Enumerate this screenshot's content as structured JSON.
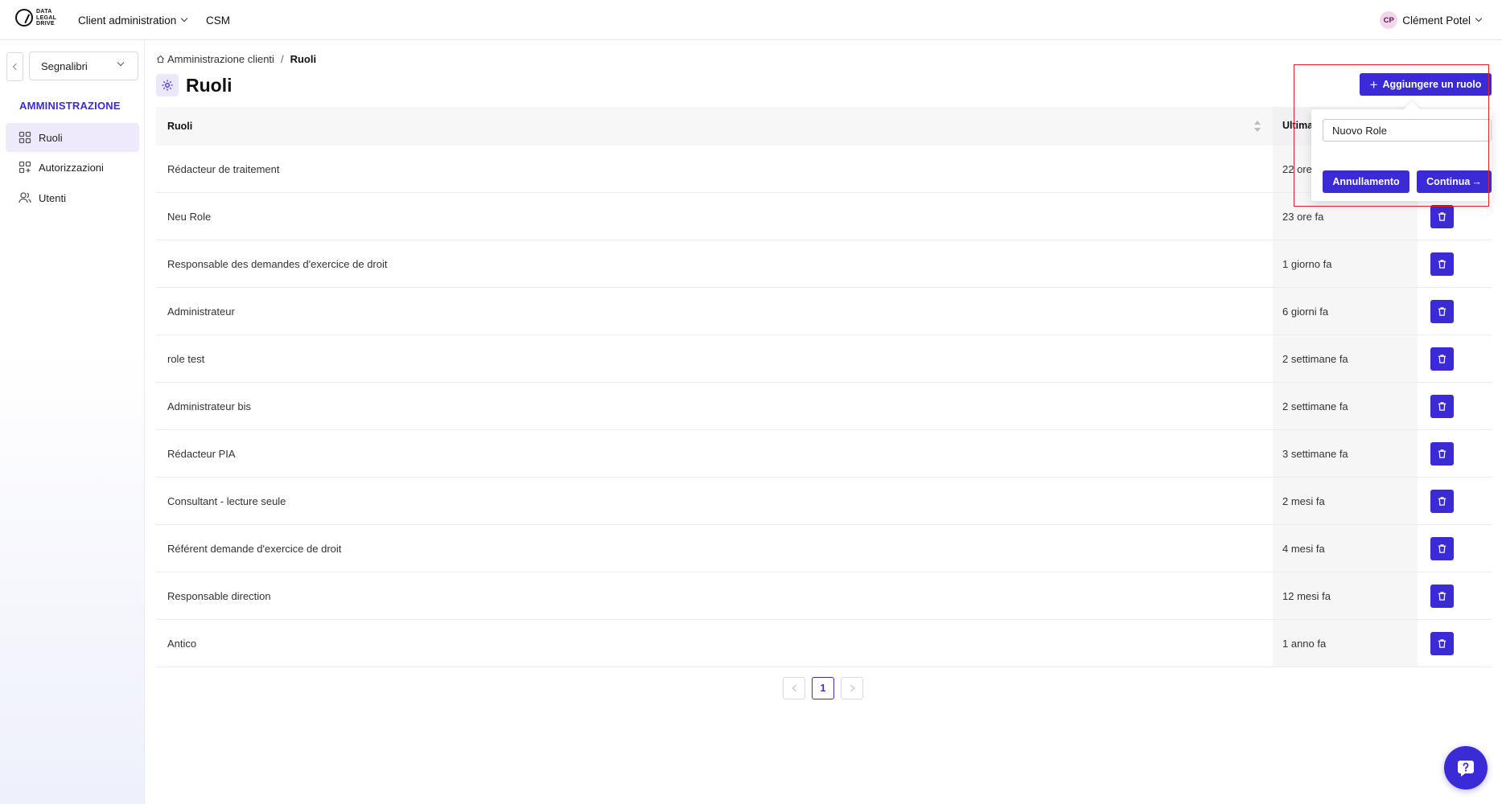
{
  "header": {
    "logo_lines": [
      "DATA",
      "LEGAL",
      "DRIVE"
    ],
    "nav_client": "Client administration",
    "nav_csm": "CSM",
    "user_initials": "CP",
    "user_name": "Clément Potel"
  },
  "sidebar": {
    "bookmarks_label": "Segnalibri",
    "section_title": "AMMINISTRAZIONE",
    "items": [
      {
        "label": "Ruoli",
        "icon": "grid-icon",
        "active": true
      },
      {
        "label": "Autorizzazioni",
        "icon": "nodes-icon",
        "active": false
      },
      {
        "label": "Utenti",
        "icon": "users-icon",
        "active": false
      }
    ]
  },
  "main": {
    "breadcrumb": {
      "home": "Amministrazione clienti",
      "separator": "/",
      "current": "Ruoli"
    },
    "title": "Ruoli",
    "add_button": "Aggiungere un ruolo",
    "table": {
      "col_name": "Ruoli",
      "col_date": "Ultima",
      "rows": [
        {
          "name": "Rédacteur de traitement",
          "date": "22 ore fa"
        },
        {
          "name": "Neu Role",
          "date": "23 ore fa"
        },
        {
          "name": "Responsable des demandes d'exercice de droit",
          "date": "1 giorno fa"
        },
        {
          "name": "Administrateur",
          "date": "6 giorni fa"
        },
        {
          "name": "role test",
          "date": "2 settimane fa"
        },
        {
          "name": "Administrateur bis",
          "date": "2 settimane fa"
        },
        {
          "name": "Rédacteur PIA",
          "date": "3 settimane fa"
        },
        {
          "name": "Consultant - lecture seule",
          "date": "2 mesi fa"
        },
        {
          "name": "Référent demande d'exercice de droit",
          "date": "4 mesi fa"
        },
        {
          "name": "Responsable direction",
          "date": "12 mesi fa"
        },
        {
          "name": "Antico",
          "date": "1 anno fa"
        }
      ]
    },
    "pagination": {
      "current_page": "1"
    }
  },
  "popover": {
    "input_value": "Nuovo Role",
    "cancel_label": "Annullamento",
    "continue_label": "Continua"
  },
  "colors": {
    "accent": "#3b2bd6",
    "highlight": "#e0202a",
    "avatar_bg": "#f3d6ec"
  }
}
